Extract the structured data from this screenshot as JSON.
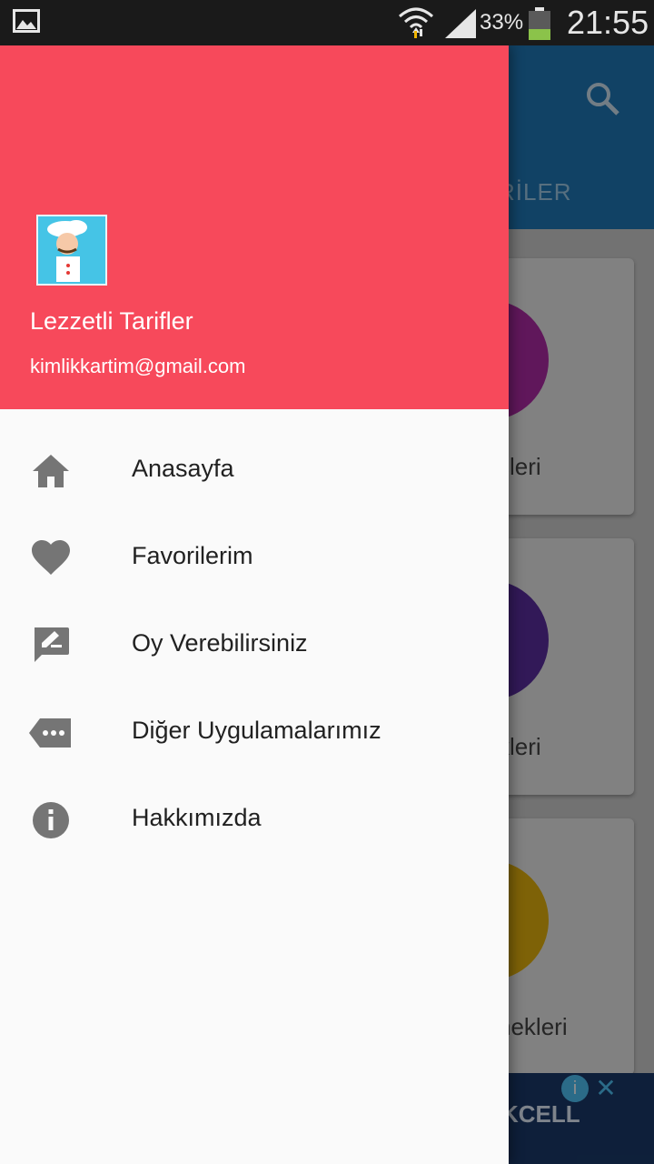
{
  "status_bar": {
    "battery_percent": "33%",
    "time": "21:55",
    "icons": [
      "gallery-icon",
      "wifi-icon",
      "signal-icon",
      "battery-icon"
    ]
  },
  "background_app": {
    "tab_fragment": "RİLER",
    "card_labels": [
      "şleri",
      "kleri",
      "nekleri"
    ],
    "ad_text": "KCELL",
    "toolbar_color": "#1f78b8",
    "card_circle_colors": [
      "#b02aa6",
      "#5b2ea0",
      "#e6b30d"
    ]
  },
  "drawer": {
    "header": {
      "title": "Lezzetli Tarifler",
      "email": "kimlikkartim@gmail.com",
      "background_color": "#f7495b"
    },
    "menu": [
      {
        "label": "Anasayfa",
        "icon": "home-icon"
      },
      {
        "label": "Favorilerim",
        "icon": "heart-icon"
      },
      {
        "label": "Oy Verebilirsiniz",
        "icon": "rate-review-icon"
      },
      {
        "label": "Diğer Uygulamalarımız",
        "icon": "more-apps-icon"
      },
      {
        "label": "Hakkımızda",
        "icon": "info-icon"
      }
    ]
  }
}
